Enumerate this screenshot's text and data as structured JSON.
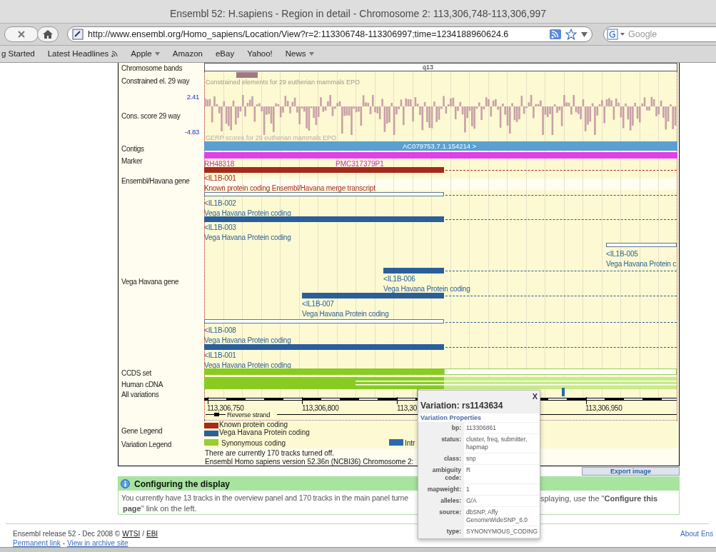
{
  "window": {
    "title": "Ensembl 52: H.sapiens - Region in detail - Chromosome 2: 113,306,748-113,306,997"
  },
  "toolbar": {
    "url": "http://www.ensembl.org/Homo_sapiens/Location/View?r=2:113306748-113306997;time=1234188960624.6",
    "search_placeholder": "Google"
  },
  "bookmarks": [
    {
      "label": "g Started",
      "kind": "link"
    },
    {
      "label": "Latest Headlines",
      "kind": "feed"
    },
    {
      "label": "Apple",
      "kind": "menu"
    },
    {
      "label": "Amazon",
      "kind": "link"
    },
    {
      "label": "eBay",
      "kind": "link"
    },
    {
      "label": "Yahoo!",
      "kind": "link"
    },
    {
      "label": "News",
      "kind": "menu"
    }
  ],
  "track_labels": [
    "Chromosome bands",
    "Constrained el. 29 way",
    "Cons. score 29 way",
    "Contigs",
    "Marker",
    "Ensembl/Havana gene",
    "Vega Havana gene",
    "CCDS set",
    "Human cDNA",
    "All variations",
    "Gene Legend",
    "Variation Legend"
  ],
  "score_scale": [
    "2.41",
    "-4.83"
  ],
  "band_label": "q13",
  "constrained_caption": "Constrained elements for 29 eutherian mammals EPO",
  "gerp_caption": "GERP scores for 29 eutherian mammals EPO",
  "contig_label": "AC079753.7.1.154214 >",
  "markers": [
    "RH48318",
    "PMC317379P1"
  ],
  "transcripts": [
    {
      "name": "<IL1B-001",
      "caption": "Known protein coding Ensembl/Havana merge transcript",
      "kind": "known",
      "filled": true
    },
    {
      "name": "<IL1B-002",
      "caption": "Vega Havana Protein coding",
      "kind": "vega",
      "filled": false
    },
    {
      "name": "<IL1B-003",
      "caption": "Vega Havana Protein coding",
      "kind": "vega",
      "filled": true
    },
    {
      "name": "<IL1B-005",
      "caption": "Vega Havana Protein c",
      "kind": "vega",
      "filled": false
    },
    {
      "name": "<IL1B-006",
      "caption": "Vega Havana Protein coding",
      "kind": "vega",
      "filled": true
    },
    {
      "name": "<IL1B-007",
      "caption": "Vega Havana Protein coding",
      "kind": "vega",
      "filled": true
    },
    {
      "name": "<IL1B-008",
      "caption": "Vega Havana Protein coding",
      "kind": "vega",
      "filled": false
    },
    {
      "name": "<IL1B-001",
      "caption": "Vega Havana Protein coding",
      "kind": "vega",
      "filled": true
    }
  ],
  "axis_labels": [
    "113,306,750",
    "113,306,800",
    "113,30",
    "113,306,950"
  ],
  "strand_label": "Reverse strand",
  "gene_legend": [
    {
      "label": "Known protein coding",
      "color": "#a52a1a"
    },
    {
      "label": "Vega Havana Protein coding",
      "color": "#2a5f9a"
    }
  ],
  "variation_legend": [
    {
      "label": "Synonymous coding",
      "color": "#99cc33"
    },
    {
      "label": "Intr",
      "color": "#2a6aaa"
    }
  ],
  "notes": [
    "There are currently 170 tracks turned off.",
    "Ensembl Homo sapiens version 52.36n (NCBI36) Chromosome 2:"
  ],
  "export_button": "Export image",
  "config_box": {
    "title": "Configuring the display",
    "line1_left": "You currently have 13 tracks in the overview panel and 170 tracks in the main panel turne",
    "line1_right": "splaying, use the \"**Configure this**",
    "line2": "**page**\" link on the left."
  },
  "popup": {
    "title": "Variation: rs1143634",
    "close": "X",
    "section": "Variation Properties",
    "rows": [
      {
        "label": "bp:",
        "value": "113306861"
      },
      {
        "label": "status:",
        "value": "cluster, freq, submitter, hapmap"
      },
      {
        "label": "class:",
        "value": "snp"
      },
      {
        "label": "ambiguity code:",
        "value": "R"
      },
      {
        "label": "mapweight:",
        "value": "1"
      },
      {
        "label": "alleles:",
        "value": "G/A"
      },
      {
        "label": "source:",
        "value": "dbSNP, Affy GenomeWideSNP_6.0"
      },
      {
        "label": "type:",
        "value": "SYNONYMOUS_CODING"
      }
    ]
  },
  "footer": {
    "release": "Ensembl release 52 - Dec 2008 ©",
    "links1": [
      "WTSI",
      "EBI"
    ],
    "separator1": "/",
    "links2": [
      "Permanent link",
      "View in archive site"
    ],
    "separator2": "-",
    "about": "About Ens"
  }
}
